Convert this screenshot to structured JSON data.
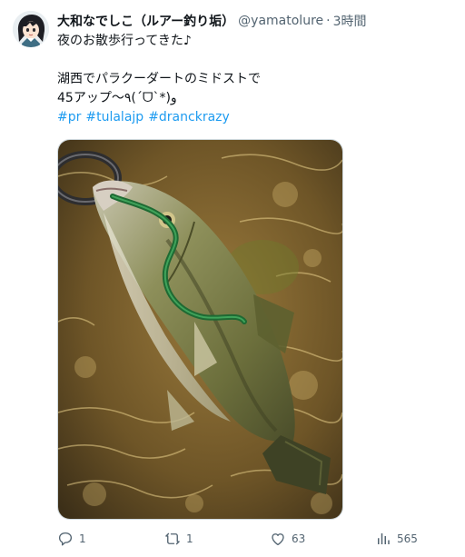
{
  "tweet": {
    "display_name": "大和なでしこ（ルアー釣り垢）",
    "handle": "@yamatolure",
    "separator": "·",
    "time": "3時間",
    "text_lines": [
      "夜のお散歩行ってきた♪",
      "",
      "湖西でパラクーダートのミドストで",
      "45アップ〜٩(ˊᗜˋ*)و"
    ],
    "hashtags": [
      "#pr",
      "#tulalajp",
      "#dranckrazy"
    ],
    "media": {
      "description": "largemouth bass with green soft-plastic worm in mouth, lying in shallow water"
    },
    "actions": {
      "reply_count": "1",
      "retweet_count": "1",
      "like_count": "63",
      "view_count": "565"
    }
  },
  "colors": {
    "text": "#0f1419",
    "secondary": "#536471",
    "link": "#1d9bf0"
  }
}
